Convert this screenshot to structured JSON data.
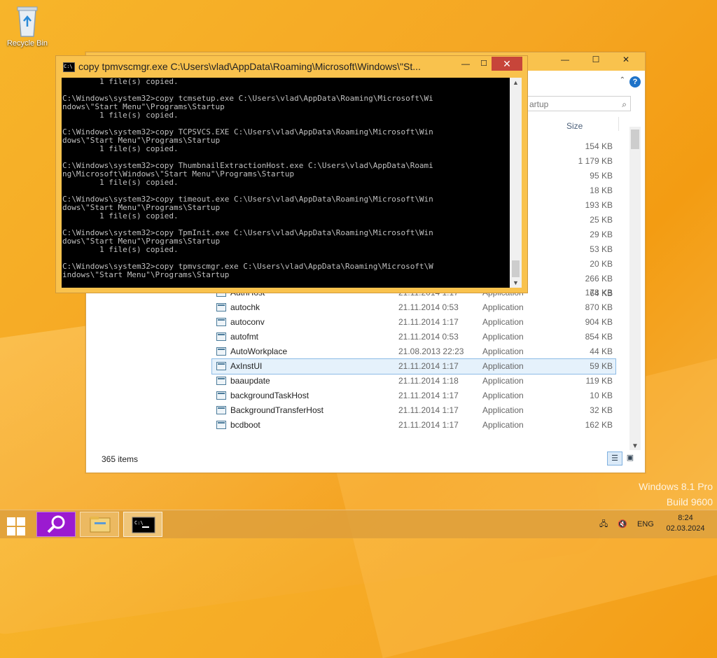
{
  "desktop": {
    "recycle_bin_label": "Recycle Bin"
  },
  "watermark": {
    "line1": "Windows 8.1 Pro",
    "line2": "Build 9600"
  },
  "explorer": {
    "search_placeholder": "artup",
    "column_size": "Size",
    "upper_sizes": [
      "154 KB",
      "1 179 KB",
      "95 KB",
      "18 KB",
      "193 KB",
      "25 KB",
      "29 KB",
      "53 KB",
      "20 KB",
      "266 KB",
      "64 KB"
    ],
    "rows": [
      {
        "name": "AuthHost",
        "date": "21.11.2014 1:17",
        "type": "Application",
        "size": "178 KB"
      },
      {
        "name": "autochk",
        "date": "21.11.2014 0:53",
        "type": "Application",
        "size": "870 KB"
      },
      {
        "name": "autoconv",
        "date": "21.11.2014 1:17",
        "type": "Application",
        "size": "904 KB"
      },
      {
        "name": "autofmt",
        "date": "21.11.2014 0:53",
        "type": "Application",
        "size": "854 KB"
      },
      {
        "name": "AutoWorkplace",
        "date": "21.08.2013 22:23",
        "type": "Application",
        "size": "44 KB"
      },
      {
        "name": "AxInstUI",
        "date": "21.11.2014 1:17",
        "type": "Application",
        "size": "59 KB"
      },
      {
        "name": "baaupdate",
        "date": "21.11.2014 1:18",
        "type": "Application",
        "size": "119 KB"
      },
      {
        "name": "backgroundTaskHost",
        "date": "21.11.2014 1:17",
        "type": "Application",
        "size": "10 KB"
      },
      {
        "name": "BackgroundTransferHost",
        "date": "21.11.2014 1:17",
        "type": "Application",
        "size": "32 KB"
      },
      {
        "name": "bcdboot",
        "date": "21.11.2014 1:17",
        "type": "Application",
        "size": "162 KB"
      }
    ],
    "selected_row_index": 5,
    "status_text": "365 items"
  },
  "cmd": {
    "title": "copy  tpmvscmgr.exe C:\\Users\\vlad\\AppData\\Roaming\\Microsoft\\Windows\\\"St...",
    "output": "        1 file(s) copied.\n\nC:\\Windows\\system32>copy tcmsetup.exe C:\\Users\\vlad\\AppData\\Roaming\\Microsoft\\Wi\nndows\\\"Start Menu\"\\Programs\\Startup\n        1 file(s) copied.\n\nC:\\Windows\\system32>copy TCPSVCS.EXE C:\\Users\\vlad\\AppData\\Roaming\\Microsoft\\Win\ndows\\\"Start Menu\"\\Programs\\Startup\n        1 file(s) copied.\n\nC:\\Windows\\system32>copy ThumbnailExtractionHost.exe C:\\Users\\vlad\\AppData\\Roami\nng\\Microsoft\\Windows\\\"Start Menu\"\\Programs\\Startup\n        1 file(s) copied.\n\nC:\\Windows\\system32>copy timeout.exe C:\\Users\\vlad\\AppData\\Roaming\\Microsoft\\Win\ndows\\\"Start Menu\"\\Programs\\Startup\n        1 file(s) copied.\n\nC:\\Windows\\system32>copy TpmInit.exe C:\\Users\\vlad\\AppData\\Roaming\\Microsoft\\Win\ndows\\\"Start Menu\"\\Programs\\Startup\n        1 file(s) copied.\n\nC:\\Windows\\system32>copy tpmvscmgr.exe C:\\Users\\vlad\\AppData\\Roaming\\Microsoft\\W\nindows\\\"Start Menu\"\\Programs\\Startup"
  },
  "taskbar": {
    "language": "ENG",
    "time": "8:24",
    "date": "02.03.2024"
  },
  "icons": {
    "search_tile": "search-icon",
    "explorer_tile": "folder-icon",
    "cmd_tile": "cmd-icon"
  }
}
